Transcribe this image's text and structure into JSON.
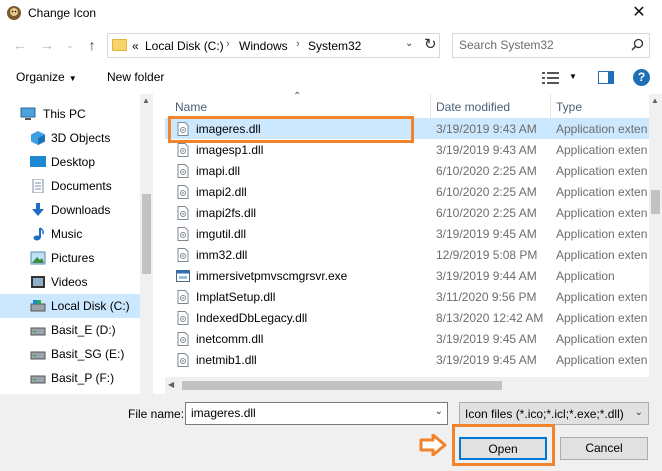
{
  "window": {
    "title": "Change Icon",
    "close": "✕"
  },
  "address": {
    "crumbs": [
      "Local Disk (C:)",
      "Windows",
      "System32"
    ],
    "overflow": "«"
  },
  "search": {
    "placeholder": "Search System32"
  },
  "toolbar": {
    "organize": "Organize",
    "new_folder": "New folder",
    "help": "?"
  },
  "nav": {
    "items": [
      {
        "label": "This PC",
        "icon": "pc-icon"
      },
      {
        "label": "3D Objects",
        "icon": "cube-icon"
      },
      {
        "label": "Desktop",
        "icon": "desktop-icon"
      },
      {
        "label": "Documents",
        "icon": "documents-icon"
      },
      {
        "label": "Downloads",
        "icon": "download-icon"
      },
      {
        "label": "Music",
        "icon": "music-icon"
      },
      {
        "label": "Pictures",
        "icon": "pictures-icon"
      },
      {
        "label": "Videos",
        "icon": "videos-icon"
      },
      {
        "label": "Local Disk (C:)",
        "icon": "drive-icon",
        "selected": true
      },
      {
        "label": "Basit_E (D:)",
        "icon": "drive-icon"
      },
      {
        "label": "Basit_SG (E:)",
        "icon": "drive-icon"
      },
      {
        "label": "Basit_P (F:)",
        "icon": "drive-icon"
      }
    ]
  },
  "columns": {
    "name": "Name",
    "date": "Date modified",
    "type": "Type"
  },
  "files": [
    {
      "name": "imageres.dll",
      "date": "3/19/2019 9:43 AM",
      "type": "Application exten",
      "selected": true
    },
    {
      "name": "imagesp1.dll",
      "date": "3/19/2019 9:43 AM",
      "type": "Application exten"
    },
    {
      "name": "imapi.dll",
      "date": "6/10/2020 2:25 AM",
      "type": "Application exten"
    },
    {
      "name": "imapi2.dll",
      "date": "6/10/2020 2:25 AM",
      "type": "Application exten"
    },
    {
      "name": "imapi2fs.dll",
      "date": "6/10/2020 2:25 AM",
      "type": "Application exten"
    },
    {
      "name": "imgutil.dll",
      "date": "3/19/2019 9:45 AM",
      "type": "Application exten"
    },
    {
      "name": "imm32.dll",
      "date": "12/9/2019 5:08 PM",
      "type": "Application exten"
    },
    {
      "name": "immersivetpmvscmgrsvr.exe",
      "date": "3/19/2019 9:44 AM",
      "type": "Application",
      "exe": true
    },
    {
      "name": "ImplatSetup.dll",
      "date": "3/11/2020 9:56 PM",
      "type": "Application exten"
    },
    {
      "name": "IndexedDbLegacy.dll",
      "date": "8/13/2020 12:42 AM",
      "type": "Application exten"
    },
    {
      "name": "inetcomm.dll",
      "date": "3/19/2019 9:45 AM",
      "type": "Application exten"
    },
    {
      "name": "inetmib1.dll",
      "date": "3/19/2019 9:45 AM",
      "type": "Application exten"
    }
  ],
  "bottom": {
    "file_name_label": "File name:",
    "file_name_value": "imageres.dll",
    "filter": "Icon files (*.ico;*.icl;*.exe;*.dll)",
    "open": "Open",
    "cancel": "Cancel"
  },
  "colors": {
    "highlight": "#f2832d",
    "selection": "#cce8ff",
    "accent": "#0078d7"
  }
}
